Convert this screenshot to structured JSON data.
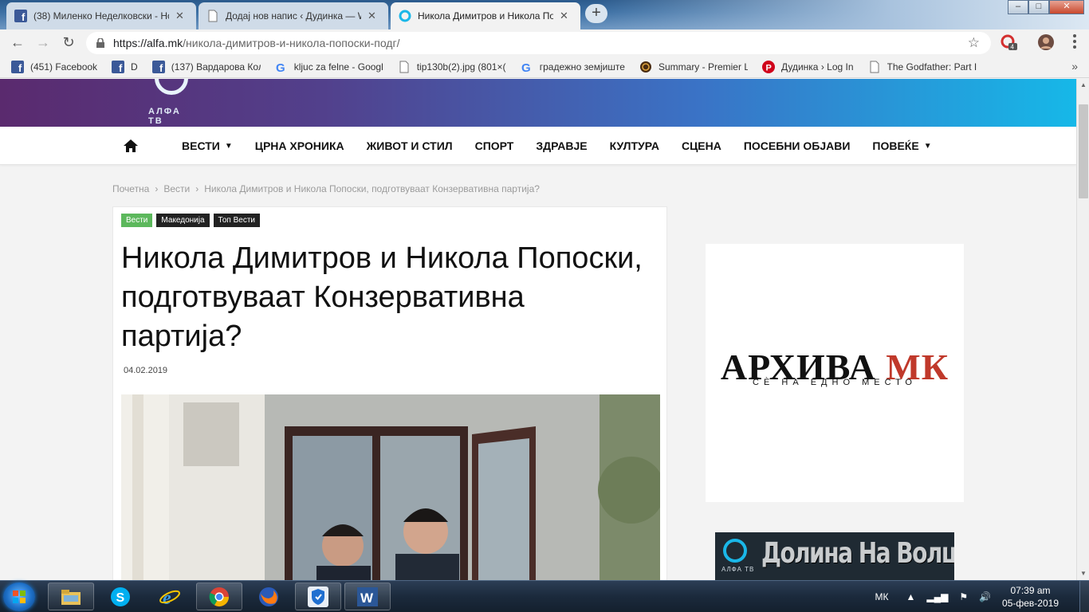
{
  "browser": {
    "tabs": [
      {
        "title": "(38) Миленко Неделковски - Но",
        "icon": "facebook-icon",
        "active": false
      },
      {
        "title": "Додај нов напис ‹ Дудинка — W",
        "icon": "page-icon",
        "active": false
      },
      {
        "title": "Никола Димитров и Никола По",
        "icon": "alfa-icon",
        "active": true
      }
    ],
    "new_tab": "+",
    "window_controls": {
      "minimize": "–",
      "maximize": "□",
      "close": "✕"
    },
    "url": {
      "domain": "https://alfa.mk",
      "path": "/никола-димитров-и-никола-попоски-подг/"
    },
    "extension_badge": "4",
    "bookmarks": [
      {
        "label": "(451) Facebook",
        "icon": "facebook-icon"
      },
      {
        "label": "D",
        "icon": "facebook-icon"
      },
      {
        "label": "(137) Вардарова Кол",
        "icon": "facebook-icon"
      },
      {
        "label": "kljuc za felne - Googl",
        "icon": "google-icon"
      },
      {
        "label": "tip130b(2).jpg (801×(",
        "icon": "page-icon"
      },
      {
        "label": "градежно земјиште",
        "icon": "google-icon"
      },
      {
        "label": "Summary - Premier L",
        "icon": "globe-icon"
      },
      {
        "label": "Дудинка › Log In",
        "icon": "pinterest-icon"
      },
      {
        "label": "The Godfather: Part II",
        "icon": "page-icon"
      }
    ],
    "bookmarks_more": "»"
  },
  "site": {
    "logo_text": "АЛФА ТВ",
    "nav": [
      {
        "label": "ВЕСТИ",
        "dropdown": true
      },
      {
        "label": "ЦРНА ХРОНИКА",
        "dropdown": false
      },
      {
        "label": "ЖИВОТ И СТИЛ",
        "dropdown": false
      },
      {
        "label": "СПОРТ",
        "dropdown": false
      },
      {
        "label": "ЗДРАВЈЕ",
        "dropdown": false
      },
      {
        "label": "КУЛТУРА",
        "dropdown": false
      },
      {
        "label": "СЦЕНА",
        "dropdown": false
      },
      {
        "label": "ПОСЕБНИ ОБЈАВИ",
        "dropdown": false
      },
      {
        "label": "ПОВЕЌЕ",
        "dropdown": true
      }
    ],
    "breadcrumb": [
      "Почетна",
      "Вести",
      "Никола Димитров и Никола Попоски, подготвуваат Конзервативна партија?"
    ],
    "breadcrumb_sep": "›",
    "article": {
      "tags": [
        "Вести",
        "Македонија",
        "Топ Вести"
      ],
      "title": "Никола Димитров и Никола Попоски, подготвуваат Конзервативна партија?",
      "date": "04.02.2019"
    },
    "ad": {
      "title_main": "АРХИВА ",
      "title_accent": "МК",
      "subtitle": "СЀ НА ЕДНО МЕСТО"
    },
    "promo": {
      "text": "Долина На Волците",
      "logo_text": "АЛФА ТВ"
    }
  },
  "taskbar": {
    "apps": [
      "explorer",
      "skype",
      "internet-explorer",
      "chrome",
      "firefox",
      "mcafee",
      "word"
    ],
    "language": "МК",
    "time": "07:39 am",
    "date": "05-фев-2019"
  },
  "colors": {
    "accent_green": "#5cb85c",
    "brand_gradient_start": "#5a2a6e",
    "brand_gradient_end": "#16b8e8",
    "ad_red": "#c0392b"
  }
}
